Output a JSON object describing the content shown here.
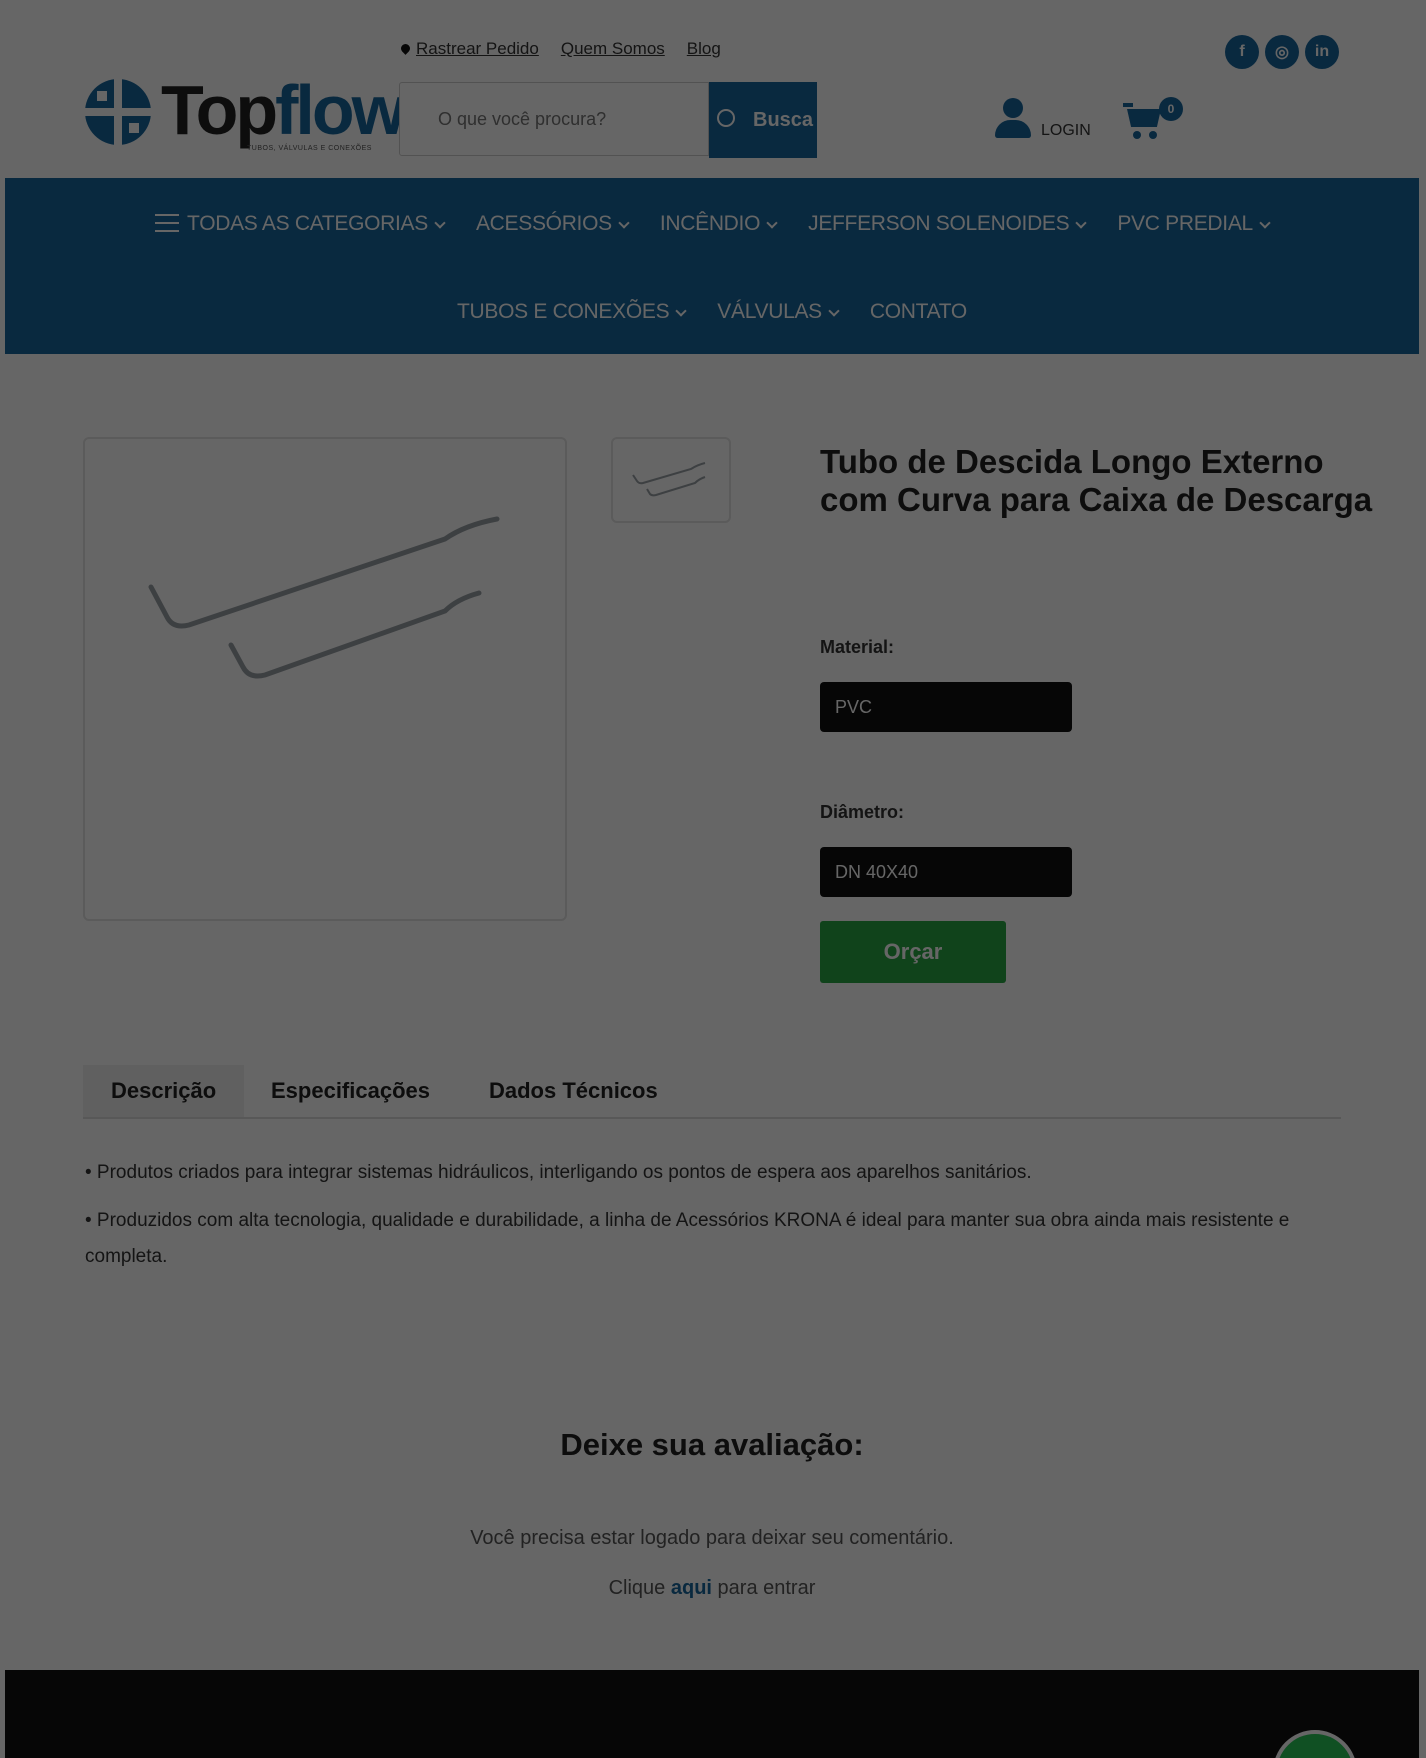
{
  "header": {
    "top_links": [
      "Rastrear Pedido",
      "Quem Somos",
      "Blog"
    ],
    "social": [
      "f",
      "◎",
      "in"
    ],
    "logo": {
      "text_main": "Top",
      "text_accent": "flow",
      "tagline": "TUBOS, VÁLVULAS E CONEXÕES"
    },
    "search": {
      "placeholder": "O que você procura?",
      "button_label": "Busca"
    },
    "login_label": "LOGIN",
    "cart_count": "0"
  },
  "nav": {
    "row1": [
      {
        "label": "TODAS AS CATEGORIAS"
      },
      {
        "label": "ACESSÓRIOS"
      },
      {
        "label": "INCÊNDIO"
      },
      {
        "label": "JEFFERSON SOLENOIDES"
      },
      {
        "label": "PVC PREDIAL"
      }
    ],
    "row2": [
      {
        "label": "TUBOS E CONEXÕES"
      },
      {
        "label": "VÁLVULAS"
      },
      {
        "label": "CONTATO"
      }
    ]
  },
  "product": {
    "title": "Tubo de Descida Longo Externo com Curva para Caixa de Descarga",
    "material_label": "Material:",
    "material_value": "PVC",
    "diametro_label": "Diâmetro:",
    "diametro_value": "DN 40X40",
    "orcar_label": "Orçar"
  },
  "tabs": [
    "Descrição",
    "Especificações",
    "Dados Técnicos"
  ],
  "description": [
    "• Produtos criados para integrar sistemas hidráulicos, interligando os pontos de espera aos aparelhos sanitários.",
    "• Produzidos com alta tecnologia, qualidade e durabilidade, a linha de Acessórios KRONA é ideal para manter sua obra ainda mais resistente e completa."
  ],
  "review": {
    "title": "Deixe sua avaliação:",
    "message": "Você precisa estar logado para deixar seu comentário.",
    "link_prefix": "Clique",
    "link_text": "aqui",
    "link_suffix": "para entrar"
  },
  "colors": {
    "brand": "#17669d",
    "cta": "#28a745",
    "whatsapp": "#28c759"
  }
}
